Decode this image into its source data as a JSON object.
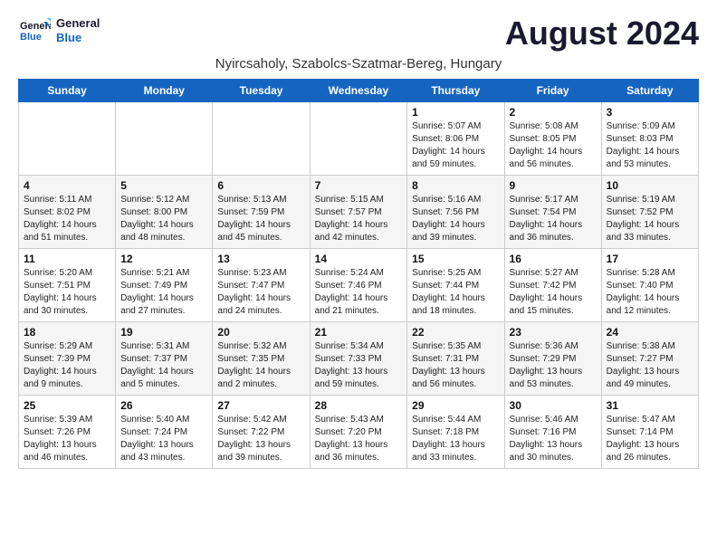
{
  "header": {
    "logo_line1": "General",
    "logo_line2": "Blue",
    "title": "August 2024",
    "subtitle": "Nyircsaholy, Szabolcs-Szatmar-Bereg, Hungary"
  },
  "weekdays": [
    "Sunday",
    "Monday",
    "Tuesday",
    "Wednesday",
    "Thursday",
    "Friday",
    "Saturday"
  ],
  "weeks": [
    [
      {
        "day": "",
        "info": ""
      },
      {
        "day": "",
        "info": ""
      },
      {
        "day": "",
        "info": ""
      },
      {
        "day": "",
        "info": ""
      },
      {
        "day": "1",
        "info": "Sunrise: 5:07 AM\nSunset: 8:06 PM\nDaylight: 14 hours\nand 59 minutes."
      },
      {
        "day": "2",
        "info": "Sunrise: 5:08 AM\nSunset: 8:05 PM\nDaylight: 14 hours\nand 56 minutes."
      },
      {
        "day": "3",
        "info": "Sunrise: 5:09 AM\nSunset: 8:03 PM\nDaylight: 14 hours\nand 53 minutes."
      }
    ],
    [
      {
        "day": "4",
        "info": "Sunrise: 5:11 AM\nSunset: 8:02 PM\nDaylight: 14 hours\nand 51 minutes."
      },
      {
        "day": "5",
        "info": "Sunrise: 5:12 AM\nSunset: 8:00 PM\nDaylight: 14 hours\nand 48 minutes."
      },
      {
        "day": "6",
        "info": "Sunrise: 5:13 AM\nSunset: 7:59 PM\nDaylight: 14 hours\nand 45 minutes."
      },
      {
        "day": "7",
        "info": "Sunrise: 5:15 AM\nSunset: 7:57 PM\nDaylight: 14 hours\nand 42 minutes."
      },
      {
        "day": "8",
        "info": "Sunrise: 5:16 AM\nSunset: 7:56 PM\nDaylight: 14 hours\nand 39 minutes."
      },
      {
        "day": "9",
        "info": "Sunrise: 5:17 AM\nSunset: 7:54 PM\nDaylight: 14 hours\nand 36 minutes."
      },
      {
        "day": "10",
        "info": "Sunrise: 5:19 AM\nSunset: 7:52 PM\nDaylight: 14 hours\nand 33 minutes."
      }
    ],
    [
      {
        "day": "11",
        "info": "Sunrise: 5:20 AM\nSunset: 7:51 PM\nDaylight: 14 hours\nand 30 minutes."
      },
      {
        "day": "12",
        "info": "Sunrise: 5:21 AM\nSunset: 7:49 PM\nDaylight: 14 hours\nand 27 minutes."
      },
      {
        "day": "13",
        "info": "Sunrise: 5:23 AM\nSunset: 7:47 PM\nDaylight: 14 hours\nand 24 minutes."
      },
      {
        "day": "14",
        "info": "Sunrise: 5:24 AM\nSunset: 7:46 PM\nDaylight: 14 hours\nand 21 minutes."
      },
      {
        "day": "15",
        "info": "Sunrise: 5:25 AM\nSunset: 7:44 PM\nDaylight: 14 hours\nand 18 minutes."
      },
      {
        "day": "16",
        "info": "Sunrise: 5:27 AM\nSunset: 7:42 PM\nDaylight: 14 hours\nand 15 minutes."
      },
      {
        "day": "17",
        "info": "Sunrise: 5:28 AM\nSunset: 7:40 PM\nDaylight: 14 hours\nand 12 minutes."
      }
    ],
    [
      {
        "day": "18",
        "info": "Sunrise: 5:29 AM\nSunset: 7:39 PM\nDaylight: 14 hours\nand 9 minutes."
      },
      {
        "day": "19",
        "info": "Sunrise: 5:31 AM\nSunset: 7:37 PM\nDaylight: 14 hours\nand 5 minutes."
      },
      {
        "day": "20",
        "info": "Sunrise: 5:32 AM\nSunset: 7:35 PM\nDaylight: 14 hours\nand 2 minutes."
      },
      {
        "day": "21",
        "info": "Sunrise: 5:34 AM\nSunset: 7:33 PM\nDaylight: 13 hours\nand 59 minutes."
      },
      {
        "day": "22",
        "info": "Sunrise: 5:35 AM\nSunset: 7:31 PM\nDaylight: 13 hours\nand 56 minutes."
      },
      {
        "day": "23",
        "info": "Sunrise: 5:36 AM\nSunset: 7:29 PM\nDaylight: 13 hours\nand 53 minutes."
      },
      {
        "day": "24",
        "info": "Sunrise: 5:38 AM\nSunset: 7:27 PM\nDaylight: 13 hours\nand 49 minutes."
      }
    ],
    [
      {
        "day": "25",
        "info": "Sunrise: 5:39 AM\nSunset: 7:26 PM\nDaylight: 13 hours\nand 46 minutes."
      },
      {
        "day": "26",
        "info": "Sunrise: 5:40 AM\nSunset: 7:24 PM\nDaylight: 13 hours\nand 43 minutes."
      },
      {
        "day": "27",
        "info": "Sunrise: 5:42 AM\nSunset: 7:22 PM\nDaylight: 13 hours\nand 39 minutes."
      },
      {
        "day": "28",
        "info": "Sunrise: 5:43 AM\nSunset: 7:20 PM\nDaylight: 13 hours\nand 36 minutes."
      },
      {
        "day": "29",
        "info": "Sunrise: 5:44 AM\nSunset: 7:18 PM\nDaylight: 13 hours\nand 33 minutes."
      },
      {
        "day": "30",
        "info": "Sunrise: 5:46 AM\nSunset: 7:16 PM\nDaylight: 13 hours\nand 30 minutes."
      },
      {
        "day": "31",
        "info": "Sunrise: 5:47 AM\nSunset: 7:14 PM\nDaylight: 13 hours\nand 26 minutes."
      }
    ]
  ]
}
